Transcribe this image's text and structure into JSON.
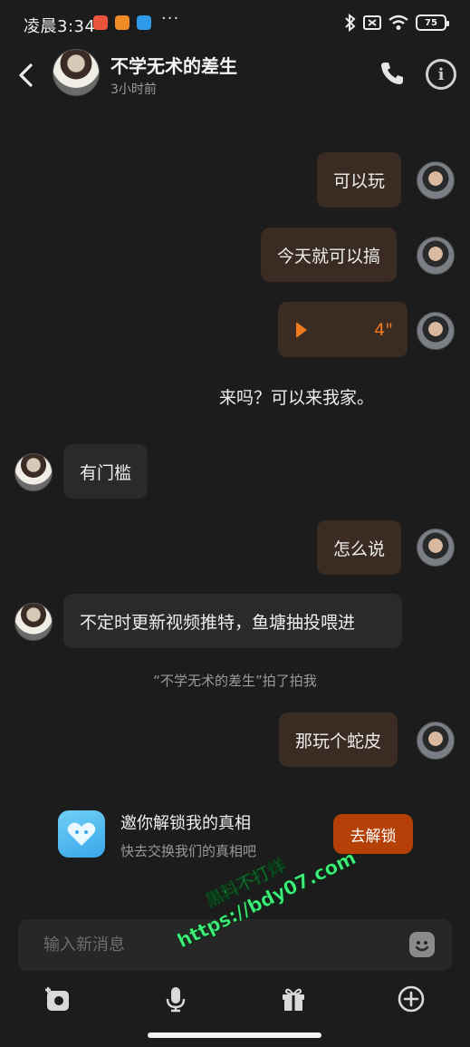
{
  "status_bar": {
    "time": "凌晨3:34",
    "more": "···",
    "battery": "75"
  },
  "header": {
    "contact_name": "不学无术的差生",
    "last_active": "3小时前"
  },
  "messages": [
    {
      "side": "me",
      "type": "text",
      "text": "可以玩"
    },
    {
      "side": "me",
      "type": "text",
      "text": "今天就可以搞"
    },
    {
      "side": "me",
      "type": "voice",
      "duration": "4\""
    },
    {
      "side": "me",
      "type": "plain",
      "text": "来吗？可以来我家。"
    },
    {
      "side": "her",
      "type": "text",
      "text": "有门槛"
    },
    {
      "side": "me",
      "type": "text",
      "text": "怎么说"
    },
    {
      "side": "her",
      "type": "text",
      "text": "不定时更新视频推特，鱼塘抽投喂进"
    },
    {
      "side": "system",
      "type": "system",
      "text": "“不学无术的差生”拍了拍我"
    },
    {
      "side": "me",
      "type": "text",
      "text": "那玩个蛇皮"
    }
  ],
  "unlock_card": {
    "title": "邀你解锁我的真相",
    "subtitle": "快去交换我们的真相吧",
    "button": "去解锁"
  },
  "composer": {
    "placeholder": "输入新消息"
  },
  "watermark": {
    "line1": "黑料不打烊",
    "line2": "https://bdy07.com"
  },
  "colors": {
    "accent": "#f07a1e",
    "my_bubble": "#3a2c22",
    "her_bubble": "#2a2a2a",
    "unlock_button": "#b54008",
    "background": "#1c1c1c"
  }
}
